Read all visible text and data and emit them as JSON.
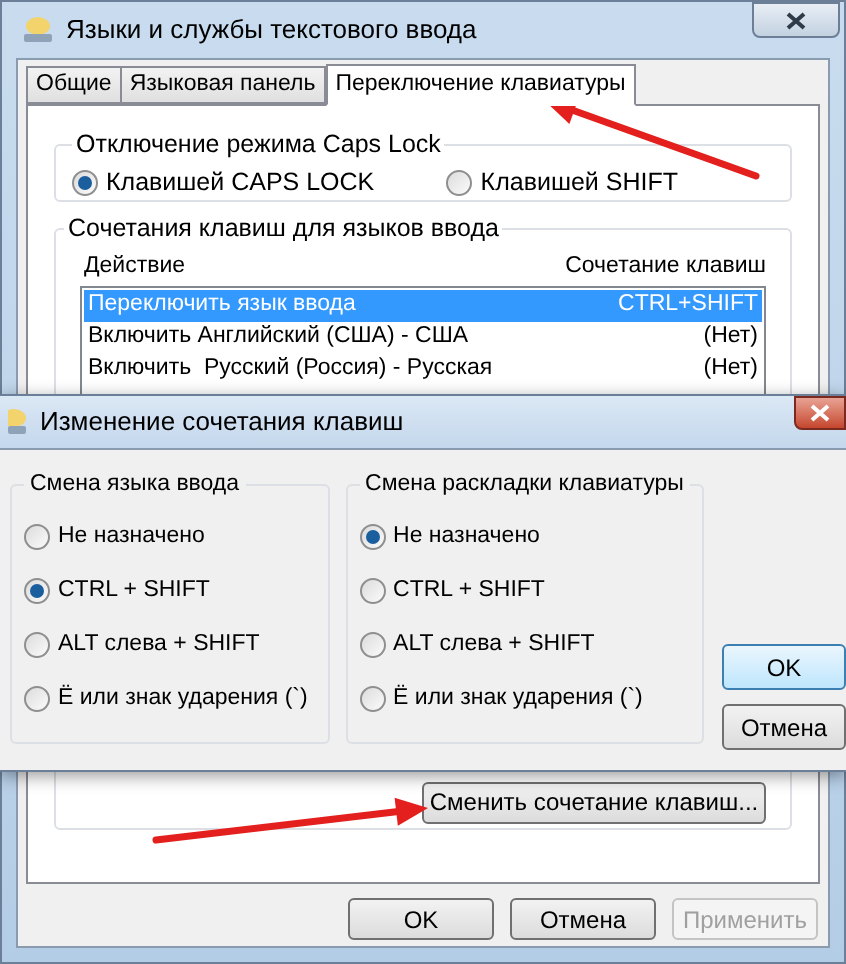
{
  "window": {
    "title": "Языки и службы текстового ввода"
  },
  "tabs": [
    {
      "label": "Общие",
      "selected": false
    },
    {
      "label": "Языковая панель",
      "selected": false
    },
    {
      "label": "Переключение клавиатуры",
      "selected": true
    }
  ],
  "caps_lock": {
    "title": "Отключение режима Caps Lock",
    "options": [
      {
        "label": "Клавишей CAPS LOCK",
        "selected": true
      },
      {
        "label": "Клавишей SHIFT",
        "selected": false
      }
    ]
  },
  "hotkeys": {
    "title": "Сочетания клавиш для языков ввода",
    "columns": [
      "Действие",
      "Сочетание клавиш"
    ],
    "rows": [
      {
        "action": "Переключить язык ввода",
        "keys": "CTRL+SHIFT",
        "selected": true
      },
      {
        "action": "Включить Английский (США) - США",
        "keys": "(Нет)",
        "selected": false
      },
      {
        "action": "Включить  Русский (Россия) - Русская",
        "keys": "(Нет)",
        "selected": false
      }
    ],
    "change_button": "Сменить сочетание клавиш..."
  },
  "buttons": [
    {
      "label": "OK",
      "disabled": false
    },
    {
      "label": "Отмена",
      "disabled": false
    },
    {
      "label": "Применить",
      "disabled": true
    }
  ],
  "dialog": {
    "title": "Изменение сочетания клавиш",
    "groups": [
      {
        "title": "Смена языка ввода",
        "options": [
          {
            "label": "Не назначено",
            "selected": false
          },
          {
            "label": "CTRL + SHIFT",
            "selected": true
          },
          {
            "label": "ALT слева + SHIFT",
            "selected": false
          },
          {
            "label": "Ё или знак ударения (`)",
            "selected": false
          }
        ]
      },
      {
        "title": "Смена раскладки клавиатуры",
        "options": [
          {
            "label": "Не назначено",
            "selected": true
          },
          {
            "label": "CTRL + SHIFT",
            "selected": false
          },
          {
            "label": "ALT слева + SHIFT",
            "selected": false
          },
          {
            "label": "Ё или знак ударения (`)",
            "selected": false
          }
        ]
      }
    ],
    "buttons": [
      {
        "label": "OK",
        "default": true
      },
      {
        "label": "Отмена",
        "default": false
      }
    ]
  }
}
